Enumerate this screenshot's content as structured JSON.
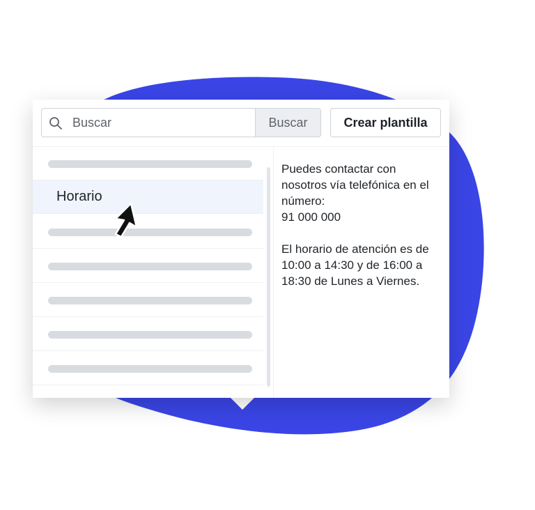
{
  "colors": {
    "accent_blob": "#3a45e6",
    "selected_row": "#f0f4fc"
  },
  "search": {
    "placeholder": "Buscar",
    "value": "",
    "button_label": "Buscar"
  },
  "toolbar": {
    "create_label": "Crear plantilla"
  },
  "list": {
    "items": [
      {
        "type": "placeholder"
      },
      {
        "type": "text",
        "label": "Horario",
        "selected": true
      },
      {
        "type": "placeholder"
      },
      {
        "type": "placeholder"
      },
      {
        "type": "placeholder"
      },
      {
        "type": "placeholder"
      },
      {
        "type": "placeholder"
      }
    ]
  },
  "detail": {
    "line1": "Puedes contactar con",
    "line2": "nosotros vía telefónica en el",
    "line3": "número:",
    "phone": "91 000 000",
    "line4": "El horario de atención es de",
    "line5": "10:00 a 14:30 y de 16:00 a",
    "line6": "18:30 de Lunes a Viernes."
  },
  "icons": {
    "search": "search-icon",
    "pointer": "mouse-pointer-icon"
  }
}
